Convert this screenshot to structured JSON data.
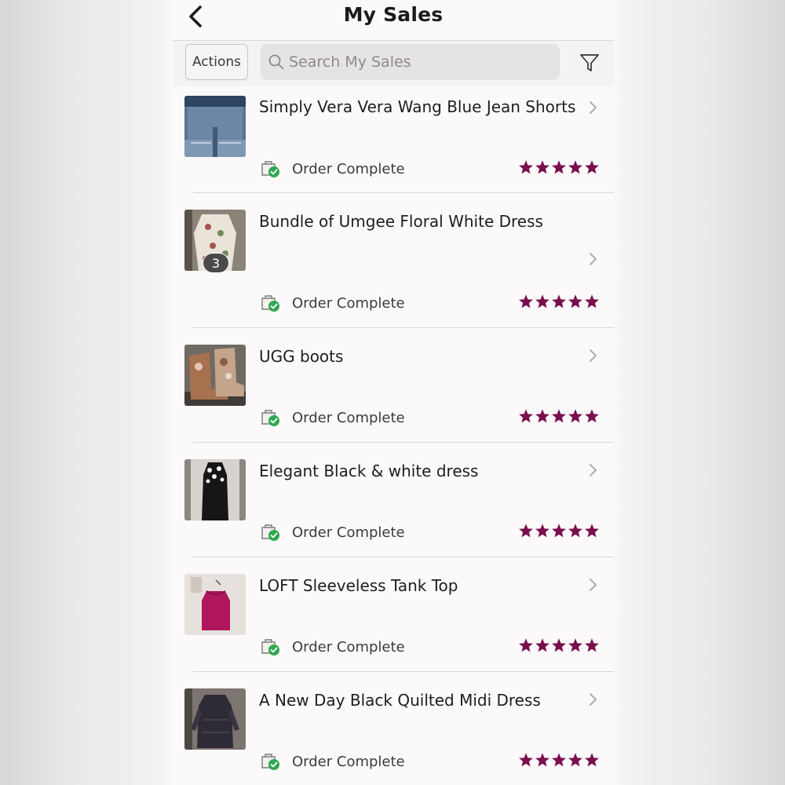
{
  "header": {
    "title": "My Sales",
    "back_icon": "chevron-left-icon"
  },
  "toolbar": {
    "actions_label": "Actions",
    "search_placeholder": "Search My Sales",
    "search_value": "",
    "filter_icon": "filter-icon"
  },
  "colors": {
    "star": "#7a0f4e",
    "status_check": "#2fa84f",
    "badge": "#4a4a4a"
  },
  "sales": [
    {
      "title": "Simply Vera Vera Wang Blue Jean Shorts",
      "status": "Order Complete",
      "rating": 5,
      "bundle_count": null
    },
    {
      "title": "Bundle of Umgee Floral White Dress",
      "status": "Order Complete",
      "rating": 5,
      "bundle_count": "3"
    },
    {
      "title": "UGG boots",
      "status": "Order Complete",
      "rating": 5,
      "bundle_count": null
    },
    {
      "title": "Elegant Black & white dress",
      "status": "Order Complete",
      "rating": 5,
      "bundle_count": null
    },
    {
      "title": "LOFT Sleeveless Tank Top",
      "status": "Order Complete",
      "rating": 5,
      "bundle_count": null
    },
    {
      "title": "A New Day Black Quilted Midi Dress",
      "status": "Order Complete",
      "rating": 5,
      "bundle_count": null
    }
  ]
}
